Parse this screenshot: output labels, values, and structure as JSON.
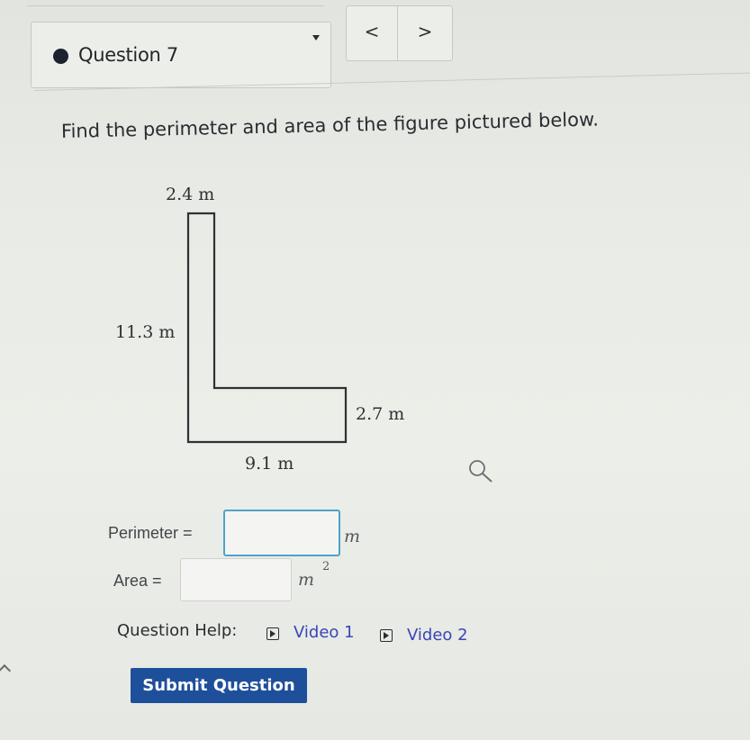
{
  "question_selector": {
    "label": "Question 7"
  },
  "nav": {
    "prev": "<",
    "next": ">"
  },
  "prompt": "Find the perimeter and area of the figure pictured below.",
  "figure": {
    "top_width": "2.4 m",
    "left_height": "11.3 m",
    "right_height": "2.7 m",
    "bottom_width": "9.1 m"
  },
  "inputs": {
    "perimeter_label": "Perimeter =",
    "perimeter_value": "",
    "perimeter_unit": "m",
    "area_label": "Area =",
    "area_value": "",
    "area_unit": "m",
    "area_exponent": "2"
  },
  "help": {
    "label": "Question Help:",
    "video1": "Video 1",
    "video2": "Video 2"
  },
  "submit": "Submit Question"
}
